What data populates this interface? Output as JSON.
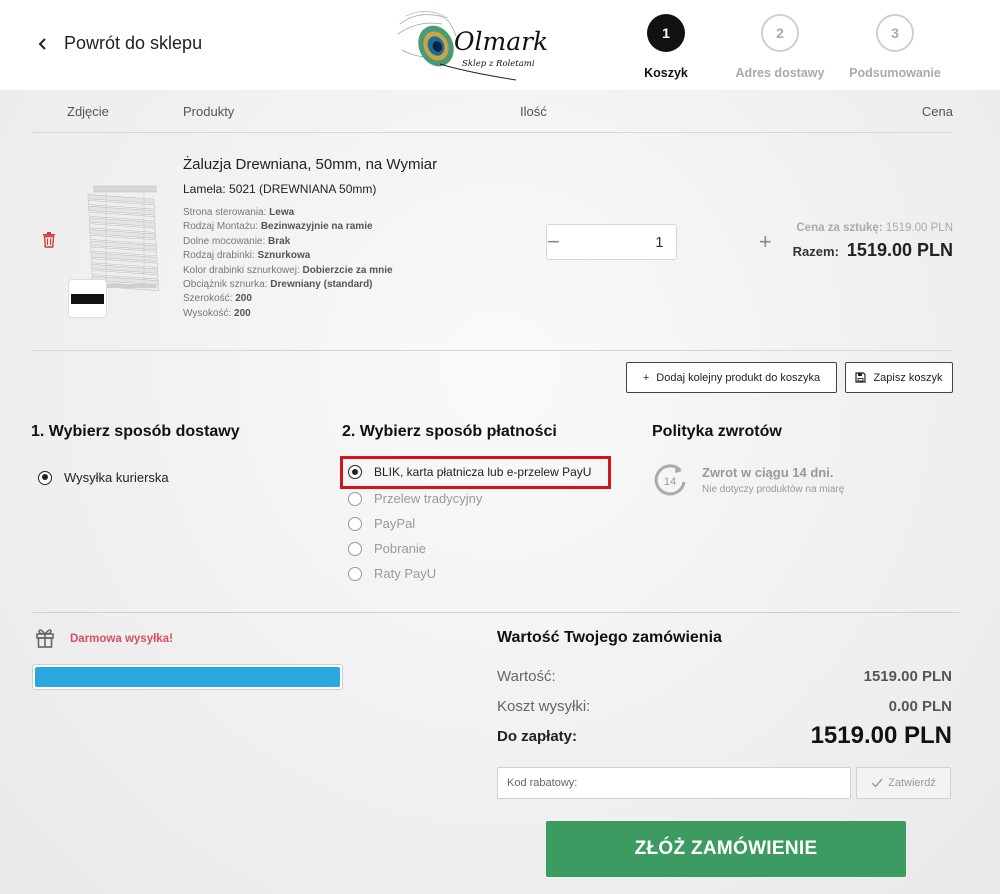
{
  "header": {
    "back_label": "Powrót do sklepu",
    "logo_title": "Olmark",
    "logo_subtitle": "Sklep z Roletami",
    "steps": [
      {
        "number": "1",
        "label": "Koszyk",
        "state": "active"
      },
      {
        "number": "2",
        "label": "Adres dostawy",
        "state": "inactive"
      },
      {
        "number": "3",
        "label": "Podsumowanie",
        "state": "inactive"
      }
    ]
  },
  "table": {
    "headers": [
      "Zdjęcie",
      "Produkty",
      "Ilość",
      "Cena"
    ]
  },
  "product": {
    "name": "Żaluzja Drewniana, 50mm, na Wymiar",
    "lamela": "Lamela: 5021 (DREWNIANA 50mm)",
    "attributes": [
      {
        "label": "Strona sterowania:",
        "value": "Lewa"
      },
      {
        "label": "Rodzaj Montażu:",
        "value": "Bezinwazyjnie na ramie"
      },
      {
        "label": "Dolne mocowanie:",
        "value": "Brak"
      },
      {
        "label": "Rodzaj drabinki:",
        "value": "Sznurkowa"
      },
      {
        "label": "Kolor drabinki sznurkowej:",
        "value": "Dobierzcie za mnie"
      },
      {
        "label": "Obciążnik sznurka:",
        "value": "Drewniany (standard)"
      },
      {
        "label": "Szerokość:",
        "value": "200"
      },
      {
        "label": "Wysokość:",
        "value": "200"
      }
    ],
    "quantity": "1",
    "qty_minus": "−",
    "qty_plus": "+",
    "unit_price_label": "Cena za sztukę:",
    "unit_price": "1519.00 PLN",
    "total_label": "Razem:",
    "total": "1519.00 PLN",
    "swatch_color": "#111111"
  },
  "actions": {
    "add_product": "Dodaj kolejny produkt do koszyka",
    "save_cart": "Zapisz koszyk"
  },
  "delivery": {
    "title": "1. Wybierz sposób dostawy",
    "options": [
      {
        "label": "Wysyłka kurierska",
        "checked": true
      }
    ]
  },
  "payment": {
    "title": "2. Wybierz sposób płatności",
    "options": [
      {
        "label": "BLIK, karta płatnicza lub e-przelew PayU",
        "checked": true
      },
      {
        "label": "Przelew tradycyjny",
        "checked": false
      },
      {
        "label": "PayPal",
        "checked": false
      },
      {
        "label": "Pobranie",
        "checked": false
      },
      {
        "label": "Raty PayU",
        "checked": false
      }
    ],
    "highlight_color": "#d0161c"
  },
  "returns": {
    "title": "Polityka zwrotów",
    "days": "14",
    "headline": "Zwrot w ciągu 14 dni.",
    "note": "Nie dotyczy produktów na miarę"
  },
  "shipping_promo": {
    "label": "Darmowa wysyłka!",
    "progress": 1.0,
    "bar_color": "#2aa7de"
  },
  "summary": {
    "title": "Wartość Twojego zamówienia",
    "value_label": "Wartość:",
    "value": "1519.00 PLN",
    "shipping_label": "Koszt wysyłki:",
    "shipping": "0.00 PLN",
    "to_pay_label": "Do zapłaty:",
    "to_pay": "1519.00 PLN",
    "discount_placeholder": "Kod rabatowy:",
    "confirm_label": "Zatwierdź",
    "order_button": "ZŁÓŻ ZAMÓWIENIE",
    "order_color": "#3b9b61"
  }
}
